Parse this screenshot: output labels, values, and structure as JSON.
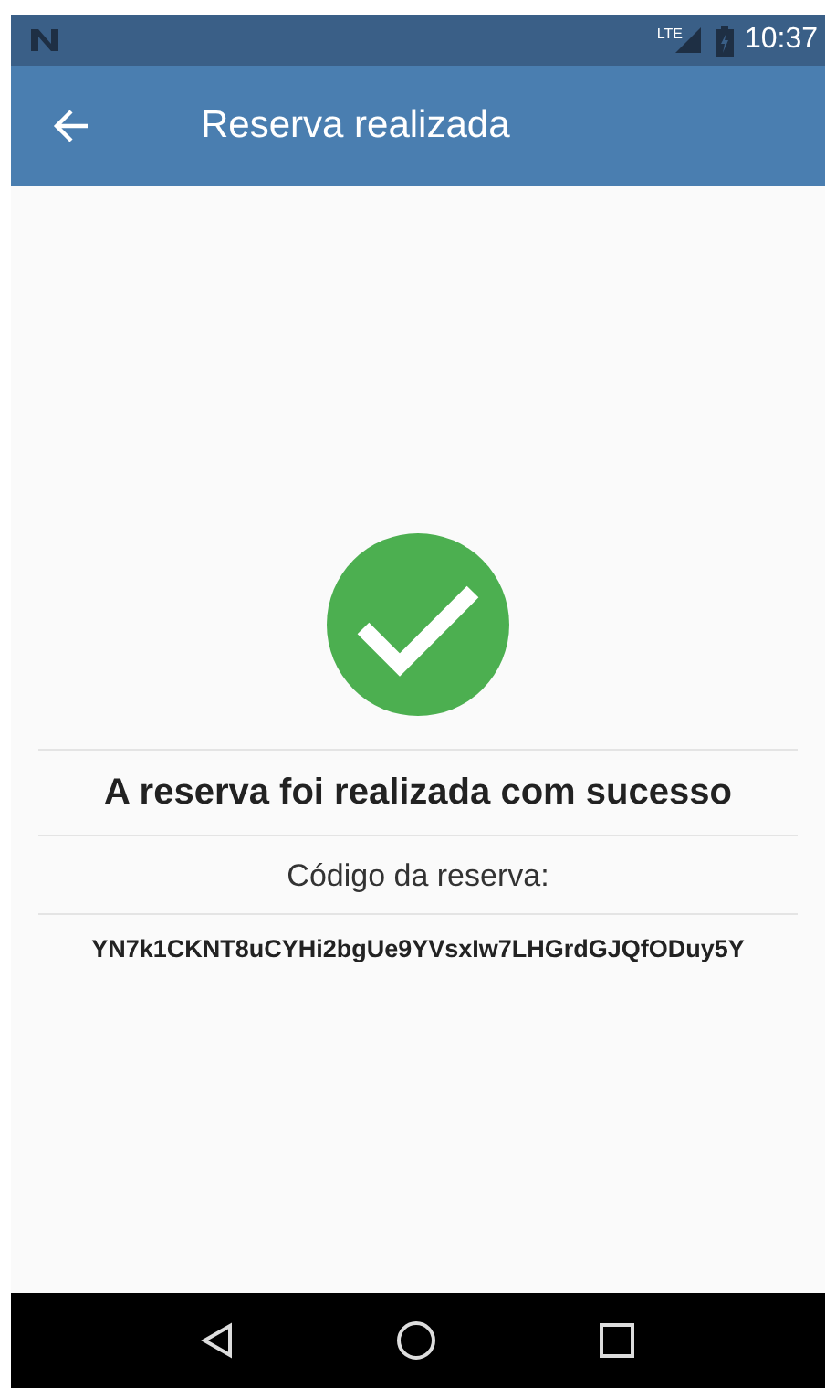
{
  "status_bar": {
    "time": "10:37",
    "network": "LTE"
  },
  "app_bar": {
    "title": "Reserva realizada"
  },
  "content": {
    "success": true,
    "message": "A reserva foi realizada com sucesso",
    "code_label": "Código da reserva:",
    "code": "YN7k1CKNT8uCYHi2bgUe9YVsxIw7LHGrdGJQfODuy5Y"
  }
}
